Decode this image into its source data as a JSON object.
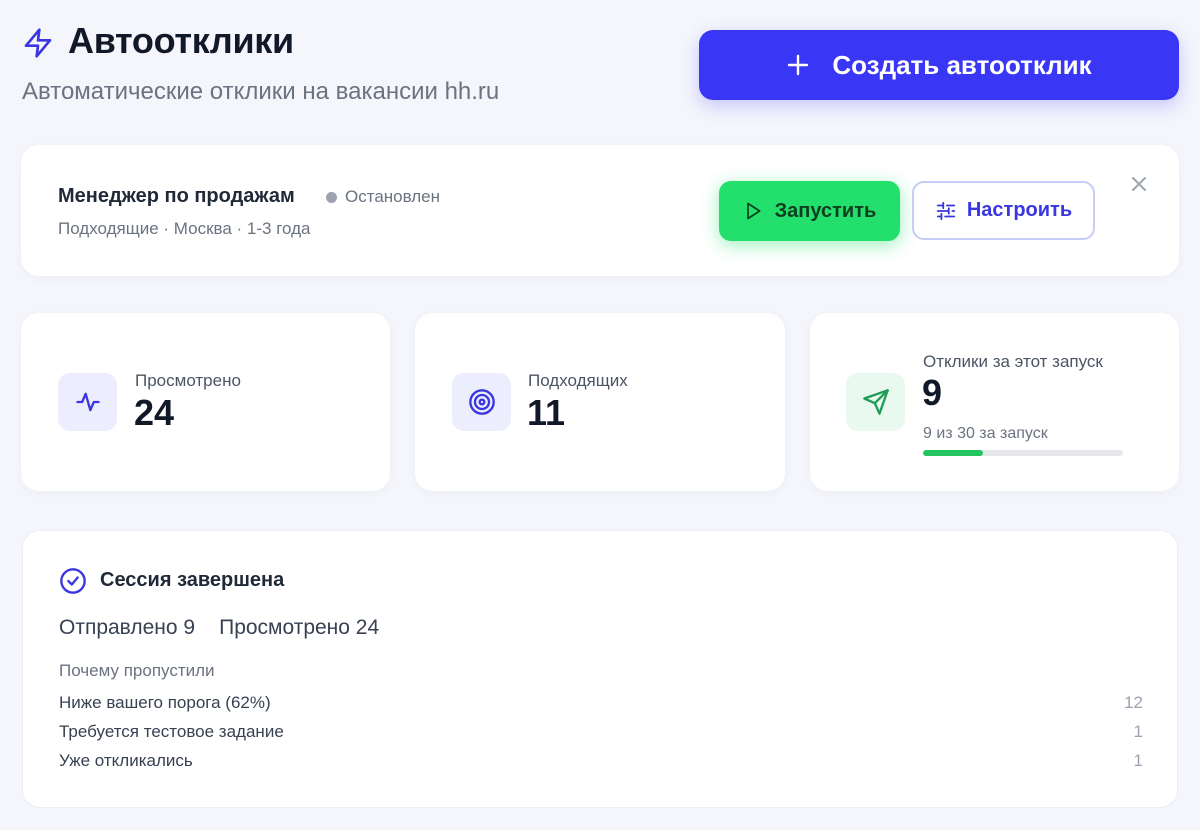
{
  "header": {
    "title": "Автоотклики",
    "subtitle": "Автоматические отклики на вакансии hh.ru",
    "icon": "lightning-icon",
    "create_button": "Создать автоотклик"
  },
  "vacancy": {
    "title": "Менеджер по продажам",
    "status": "Остановлен",
    "meta": "Подходящие · Москва · 1-3 года",
    "run_button": "Запустить",
    "settings_button": "Настроить"
  },
  "stats": {
    "viewed": {
      "label": "Просмотрено",
      "value": "24",
      "icon": "activity-icon"
    },
    "matching": {
      "label": "Подходящих",
      "value": "11",
      "icon": "target-icon"
    },
    "responses": {
      "label": "Отклики за этот запуск",
      "value": "9",
      "caption": "9 из 30 за запуск",
      "progress": 0.3,
      "icon": "send-icon"
    }
  },
  "session": {
    "title": "Сессия завершена",
    "sent": "Отправлено 9",
    "viewed": "Просмотрено 24",
    "why_title": "Почему пропустили",
    "reasons": [
      {
        "label": "Ниже вашего порога (62%)",
        "count": "12"
      },
      {
        "label": "Требуется тестовое задание",
        "count": "1"
      },
      {
        "label": "Уже откликались",
        "count": "1"
      }
    ]
  },
  "colors": {
    "accent": "#3a36f5",
    "success": "#22e06b",
    "background": "#f4f6fc"
  }
}
